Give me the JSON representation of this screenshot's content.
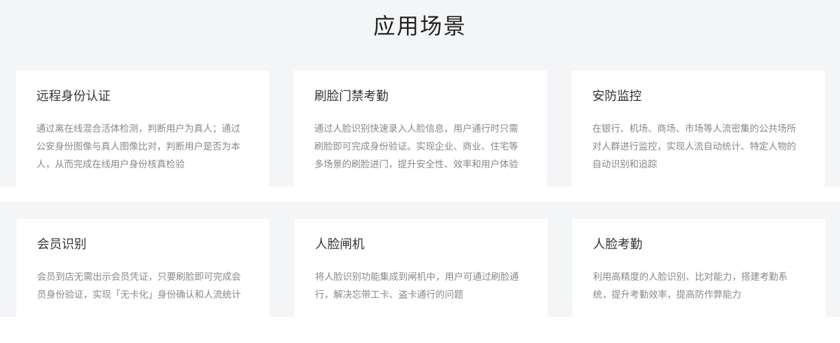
{
  "section": {
    "title": "应用场景"
  },
  "cards": [
    {
      "title": "远程身份认证",
      "desc": "通过离在线混合活体检测，判断用户为真人；通过公安身份图像与真人图像比对，判断用户是否为本人，从而完成在线用户身份核真检验"
    },
    {
      "title": "刷脸门禁考勤",
      "desc": "通过人脸识别快速录入人脸信息，用户通行时只需刷脸即可完成身份验证。实现企业、商业、住宅等多场景的刷脸进门，提升安全性、效率和用户体验"
    },
    {
      "title": "安防监控",
      "desc": "在银行、机场、商场、市场等人流密集的公共场所对人群进行监控，实现人流自动统计、特定人物的自动识别和追踪"
    },
    {
      "title": "会员识别",
      "desc": "会员到店无需出示会员凭证，只要刷脸即可完成会员身份验证，实现「无卡化」身份确认和人流统计"
    },
    {
      "title": "人脸闸机",
      "desc": "将人脸识别功能集成到闸机中，用户可通过刷脸通行，解决忘带工卡、盗卡通行的问题"
    },
    {
      "title": "人脸考勤",
      "desc": "利用高精度的人脸识别、比对能力，搭建考勤系统，提升考勤效率，提高防作弊能力"
    }
  ]
}
